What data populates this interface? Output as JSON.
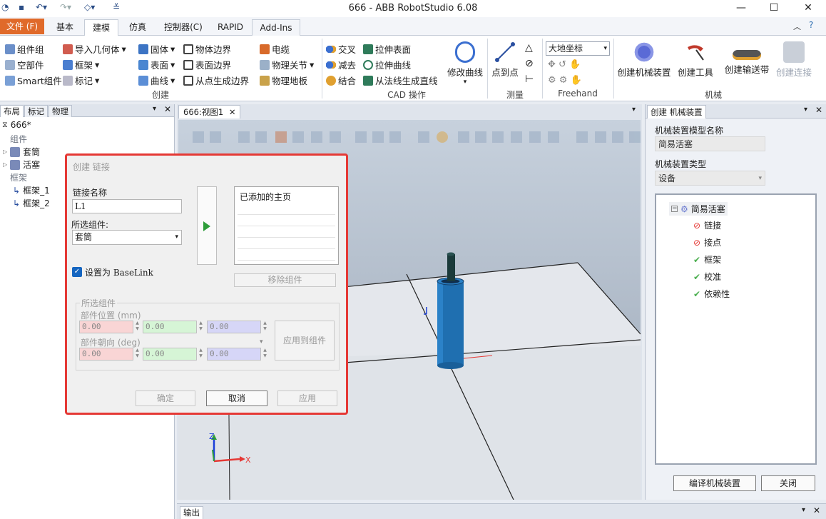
{
  "window": {
    "title": "666 - ABB RobotStudio 6.08",
    "minimize": "—",
    "maximize": "☐",
    "close": "✕"
  },
  "tabs": {
    "file": "文件 (F)",
    "basic": "基本",
    "modeling": "建模",
    "simulation": "仿真",
    "controller": "控制器(C)",
    "rapid": "RAPID",
    "addins": "Add-Ins"
  },
  "ribbon": {
    "create": {
      "label": "创建",
      "component_group": "组件组",
      "empty_part": "空部件",
      "smart_component": "Smart组件",
      "import_geometry": "导入几何体",
      "frame": "框架",
      "tag": "标记",
      "solid": "固体",
      "surface": "表面",
      "curve": "曲线",
      "body_border": "物体边界",
      "surface_border": "表面边界",
      "border_from_points": "从点生成边界",
      "cable": "电缆",
      "physics_joint": "物理关节",
      "physics_floor": "物理地板"
    },
    "cad": {
      "label": "CAD 操作",
      "intersect": "交叉",
      "subtract": "减去",
      "union": "结合",
      "extrude_surface": "拉伸表面",
      "extrude_curve": "拉伸曲线",
      "normal_line": "从法线生成直线",
      "modify_curve": "修改曲线"
    },
    "measure": {
      "label": "测量",
      "point_to_point": "点到点"
    },
    "freehand": {
      "label": "Freehand",
      "coord": "大地坐标"
    },
    "mechanism": {
      "label": "机械",
      "create_mechanism": "创建机械装置",
      "create_tool": "创建工具",
      "create_conveyor": "创建输送带",
      "create_connection": "创建连接"
    }
  },
  "left_panel": {
    "tabs": [
      "布局",
      "标记",
      "物理"
    ],
    "station": "666*",
    "components_label": "组件",
    "components": [
      "套筒",
      "活塞"
    ],
    "frames_label": "框架",
    "frames": [
      "框架_1",
      "框架_2"
    ]
  },
  "viewport": {
    "tab": "666:视图1"
  },
  "right_panel": {
    "title": "创建 机械装置",
    "model_name_label": "机械装置模型名称",
    "model_name": "简易活塞",
    "type_label": "机械装置类型",
    "type": "设备",
    "tree_root": "简易活塞",
    "tree_items": [
      "链接",
      "接点",
      "框架",
      "校准",
      "依赖性"
    ],
    "compile_button": "编译机械装置",
    "close_button": "关闭"
  },
  "output": {
    "tab": "输出"
  },
  "dialog": {
    "title": "创建 链接",
    "link_name_label": "链接名称",
    "link_name": "L1",
    "selected_component_label": "所选组件:",
    "selected_component": "套筒",
    "baselink_label": "设置为 BaseLink",
    "baselink_checked": true,
    "added_list_header": "已添加的主页",
    "remove_button": "移除组件",
    "group_label": "所选组件",
    "position_label": "部件位置 (mm)",
    "orientation_label": "部件朝向 (deg)",
    "values": {
      "px": "0.00",
      "py": "0.00",
      "pz": "0.00",
      "ox": "0.00",
      "oy": "0.00",
      "oz": "0.00"
    },
    "apply_to_component": "应用到组件",
    "ok": "确定",
    "cancel": "取消",
    "apply": "应用"
  },
  "axes": {
    "x": "X",
    "z": "Z"
  },
  "colors": {
    "file_tab": "#e06a2a",
    "dialog_border": "#e53935",
    "cylinder": "#1f6fb0",
    "x_axis": "#e53935",
    "y_axis": "#2e9d3a",
    "z_axis": "#1a3fd8"
  }
}
